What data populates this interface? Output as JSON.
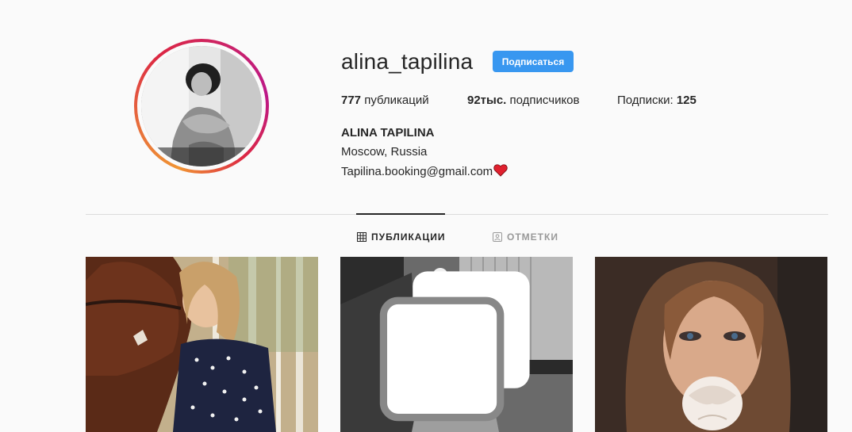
{
  "profile": {
    "username": "alina_tapilina",
    "follow_label": "Подписаться",
    "full_name": "ALINA TAPILINA",
    "bio_location": "Moscow, Russia",
    "bio_email": "Tapilina.booking@gmail.com"
  },
  "stats": {
    "posts_count": "777",
    "posts_label": "публикаций",
    "followers_count": "92тыс.",
    "followers_label": "подписчиков",
    "following_label": "Подписки:",
    "following_count": "125"
  },
  "tabs": [
    {
      "label": "ПУБЛИКАЦИИ",
      "icon": "grid-icon",
      "active": true
    },
    {
      "label": "ОТМЕТКИ",
      "icon": "tagged-user-icon",
      "active": false
    }
  ],
  "colors": {
    "follow_button": "#3897f0",
    "text": "#262626",
    "muted": "#999999",
    "background": "#fafafa",
    "heart": "#e0202e"
  },
  "posts": [
    {
      "icon": "photo-horse-woman",
      "multi": false
    },
    {
      "icon": "photo-bw-woman",
      "multi": true
    },
    {
      "icon": "photo-woman-rose",
      "multi": false
    }
  ]
}
